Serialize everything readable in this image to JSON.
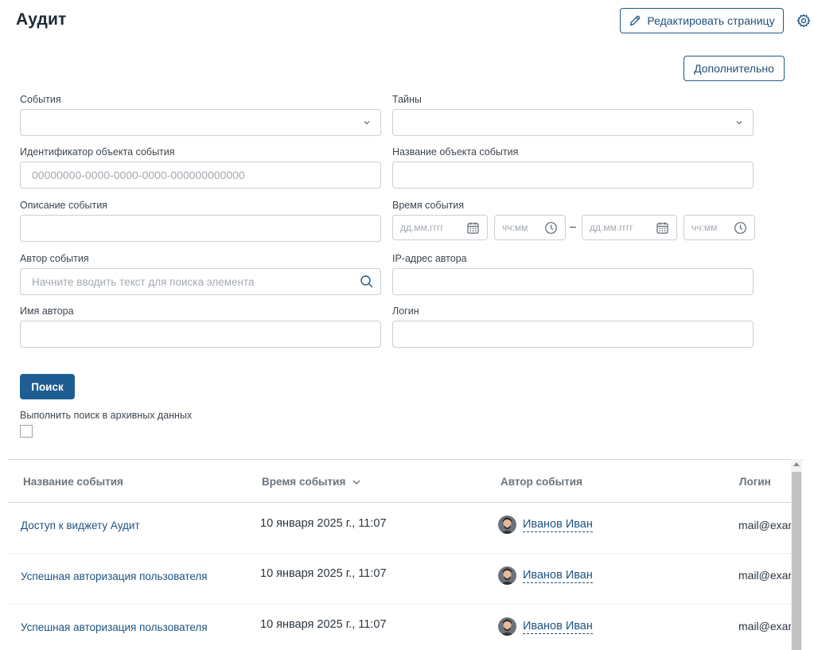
{
  "header": {
    "title": "Аудит",
    "edit_page_label": "Редактировать страницу",
    "more_label": "Дополнительно"
  },
  "filters": {
    "events": {
      "label": "События"
    },
    "secrets": {
      "label": "Тайны"
    },
    "object_id": {
      "label": "Идентификатор объекта события",
      "placeholder": "00000000-0000-0000-0000-000000000000"
    },
    "object_name": {
      "label": "Название объекта события"
    },
    "description": {
      "label": "Описание события"
    },
    "event_time": {
      "label": "Время события",
      "date_placeholder": "дд.мм.гггг",
      "time_placeholder": "чч:мм",
      "range_separator": "–"
    },
    "author": {
      "label": "Автор события",
      "placeholder": "Начните вводить текст для поиска элемента"
    },
    "author_ip": {
      "label": "IP-адрес автора"
    },
    "author_name": {
      "label": "Имя автора"
    },
    "login": {
      "label": "Логин"
    }
  },
  "search": {
    "button_label": "Поиск",
    "archive_label": "Выполнить поиск в архивных данных",
    "archive_checked": false
  },
  "table": {
    "columns": [
      "Название события",
      "Время события",
      "Автор события",
      "Логин"
    ],
    "rows": [
      {
        "event": "Доступ к виджету Аудит",
        "time": "10 января 2025 г., 11:07",
        "author": "Иванов Иван",
        "login": "mail@exam"
      },
      {
        "event": "Успешная авторизация пользователя",
        "time": "10 января 2025 г., 11:07",
        "author": "Иванов Иван",
        "login": "mail@exam"
      },
      {
        "event": "Успешная авторизация пользователя",
        "time": "10 января 2025 г., 11:07",
        "author": "Иванов Иван",
        "login": "mail@exam"
      }
    ]
  },
  "colors": {
    "accent": "#1e5d92",
    "link": "#1d5383",
    "border": "#c9cfd5"
  }
}
